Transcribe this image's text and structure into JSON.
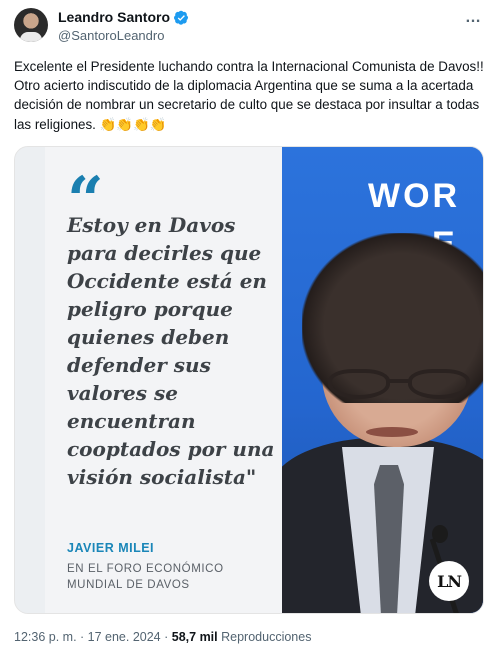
{
  "author": {
    "display_name": "Leandro Santoro",
    "handle": "@SantoroLeandro",
    "avatar_icon": "profile-photo",
    "verified_icon": "verified-badge-icon",
    "verified_color": "#1d9bf0"
  },
  "more_icon": "…",
  "tweet": {
    "text": "Excelente el Presidente luchando contra la Internacional Comunista de Davos!! Otro acierto indiscutido de la diplomacia Argentina que se suma a la acertada decisión de nombrar un secretario de culto que se destaca por insultar a todas las religiones. 👏👏👏👏"
  },
  "media": {
    "quote_mark": "“",
    "quote": "Estoy en Davos para decirles que Occidente está en peligro porque quienes deben defender sus valores se encuentran cooptados por una visión socialista\"",
    "quote_author": "JAVIER MILEI",
    "quote_context": "EN EL FORO ECONÓMICO MUNDIAL DE DAVOS",
    "backdrop_text_1": "WOR",
    "backdrop_text_2": "E",
    "logo_text": "LN",
    "accent_color": "#1a86b8",
    "backdrop_color": "#2a6fd6"
  },
  "meta": {
    "timestamp": "12:36 p. m. · 17 ene. 2024 ·",
    "views_count": "58,7 mil",
    "views_label": "Reproducciones"
  }
}
